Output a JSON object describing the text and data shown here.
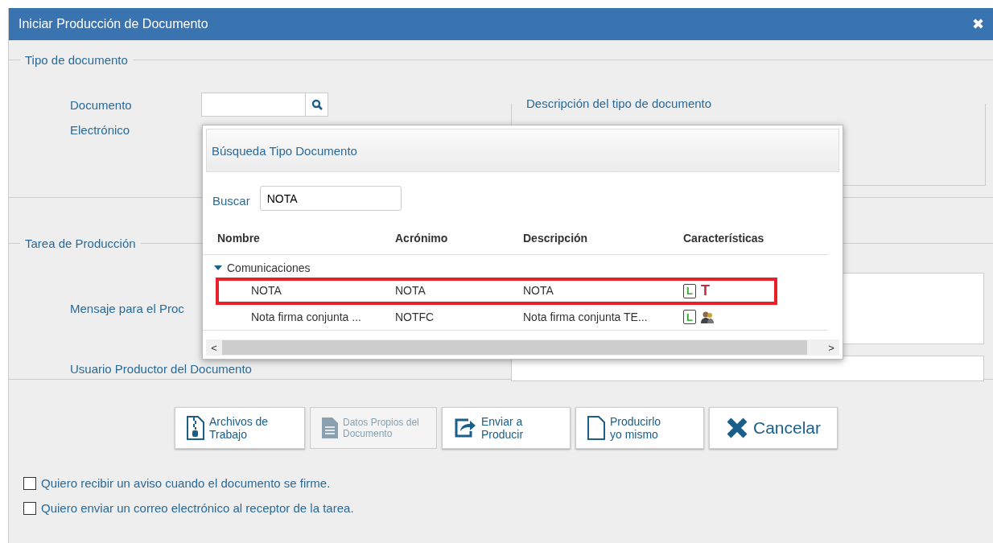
{
  "window": {
    "title": "Iniciar Producción de Documento",
    "close": "✖"
  },
  "tipo_documento": {
    "legend": "Tipo de documento",
    "label": "Documento Electrónico",
    "description_legend": "Descripción del tipo de documento"
  },
  "tarea": {
    "legend": "Tarea de Producción",
    "message_label": "Mensaje para el Proc",
    "user_label": "Usuario Productor del Documento"
  },
  "buttons": [
    {
      "lines": [
        "Archivos de",
        "Trabajo"
      ],
      "kind": "zip",
      "disabled": false
    },
    {
      "lines": [
        "Datos Propios del",
        "Documento"
      ],
      "kind": "text-doc",
      "disabled": true
    },
    {
      "lines": [
        "Enviar a",
        "Producir"
      ],
      "kind": "share",
      "disabled": false
    },
    {
      "lines": [
        "Producirlo",
        "yo mismo"
      ],
      "kind": "blank-doc",
      "disabled": false
    },
    {
      "lines": [
        "Cancelar"
      ],
      "kind": "cross",
      "disabled": false
    }
  ],
  "checkboxes": [
    {
      "label": "Quiero recibir un aviso cuando el documento se firme.",
      "checked": false
    },
    {
      "label": "Quiero enviar un correo electrónico al receptor de la tarea.",
      "checked": false
    }
  ],
  "popup": {
    "title": "Búsqueda Tipo Documento",
    "search_label": "Buscar",
    "search_value": "NOTA",
    "columns": [
      "Nombre",
      "Acrónimo",
      "Descripción",
      "Características"
    ],
    "groups": [
      {
        "name": "Comunicaciones",
        "expanded": true,
        "rows": [
          {
            "cells": [
              "NOTA",
              "NOTA",
              "NOTA"
            ],
            "highlighted": true,
            "features": [
              {
                "kind": "doc",
                "glyph": "L"
              },
              {
                "kind": "glyph",
                "glyph": "T"
              }
            ]
          },
          {
            "cells": [
              "Nota firma conjunta ...",
              "NOTFC",
              "Nota firma conjunta TE..."
            ],
            "highlighted": false,
            "features": [
              {
                "kind": "doc",
                "glyph": "L"
              },
              {
                "kind": "people"
              }
            ]
          }
        ]
      }
    ],
    "scroll_left": "<",
    "scroll_right": ">"
  }
}
